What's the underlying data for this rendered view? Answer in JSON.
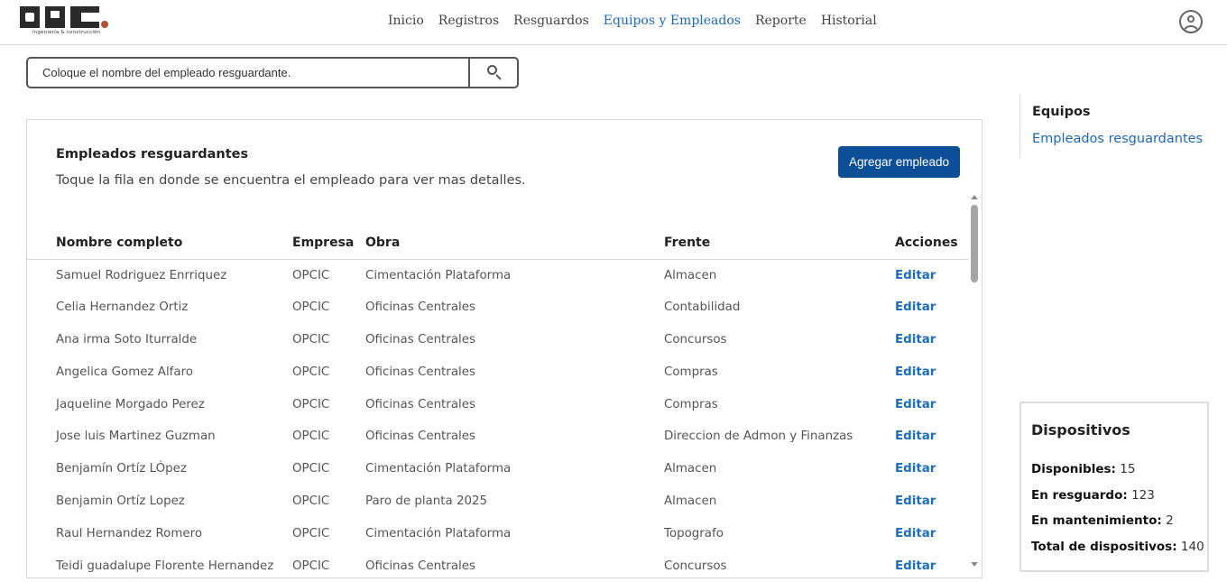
{
  "logo": {
    "text": "ingeniería & construcción"
  },
  "nav": {
    "items": [
      "Inicio",
      "Registros",
      "Resguardos",
      "Equipos y Empleados",
      "Reporte",
      "Historial"
    ],
    "active": "Equipos y Empleados"
  },
  "search": {
    "placeholder": "Coloque el nombre del empleado resguardante."
  },
  "card": {
    "title": "Empleados resguardantes",
    "subtitle": "Toque la fila en donde se encuentra el empleado para ver mas detalles.",
    "add_button": "Agregar empleado"
  },
  "table": {
    "headers": [
      "Nombre completo",
      "Empresa",
      "Obra",
      "Frente",
      "Acciones"
    ],
    "rows": [
      {
        "nombre": "Samuel Rodriguez Enrriquez",
        "empresa": "OPCIC",
        "obra": "Cimentación Plataforma",
        "frente": "Almacen",
        "accion": "Editar"
      },
      {
        "nombre": "Celia Hernandez Ortiz",
        "empresa": "OPCIC",
        "obra": "Oficinas Centrales",
        "frente": "Contabilidad",
        "accion": "Editar"
      },
      {
        "nombre": "Ana irma Soto Iturralde",
        "empresa": "OPCIC",
        "obra": "Oficinas Centrales",
        "frente": "Concursos",
        "accion": "Editar"
      },
      {
        "nombre": "Angelica Gomez Alfaro",
        "empresa": "OPCIC",
        "obra": "Oficinas Centrales",
        "frente": "Compras",
        "accion": "Editar"
      },
      {
        "nombre": "Jaqueline Morgado Perez",
        "empresa": "OPCIC",
        "obra": "Oficinas Centrales",
        "frente": "Compras",
        "accion": "Editar"
      },
      {
        "nombre": "Jose luis Martinez Guzman",
        "empresa": "OPCIC",
        "obra": "Oficinas Centrales",
        "frente": "Direccion de Admon y Finanzas",
        "accion": "Editar"
      },
      {
        "nombre": "Benjamín Ortíz LÓpez",
        "empresa": "OPCIC",
        "obra": "Cimentación Plataforma",
        "frente": "Almacen",
        "accion": "Editar"
      },
      {
        "nombre": "Benjamin Ortíz Lopez",
        "empresa": "OPCIC",
        "obra": "Paro de planta 2025",
        "frente": "Almacen",
        "accion": "Editar"
      },
      {
        "nombre": "Raul Hernandez Romero",
        "empresa": "OPCIC",
        "obra": "Cimentación Plataforma",
        "frente": "Topografo",
        "accion": "Editar"
      },
      {
        "nombre": "Teidi guadalupe Florente Hernandez",
        "empresa": "OPCIC",
        "obra": "Oficinas Centrales",
        "frente": "Concursos",
        "accion": "Editar"
      }
    ]
  },
  "sidebar": {
    "items": [
      "Equipos",
      "Empleados resguardantes"
    ]
  },
  "devices": {
    "title": "Dispositivos",
    "stats": [
      {
        "label": "Disponibles:",
        "value": "15"
      },
      {
        "label": "En resguardo:",
        "value": "123"
      },
      {
        "label": "En mantenimiento:",
        "value": "2"
      },
      {
        "label": "Total de dispositivos:",
        "value": "140"
      }
    ]
  },
  "colors": {
    "accent": "#1a67c4",
    "button": "#0d4f97",
    "edit_link": "#1a6ec2"
  },
  "icons": {
    "search": "search-icon",
    "user": "user-circle-icon"
  }
}
